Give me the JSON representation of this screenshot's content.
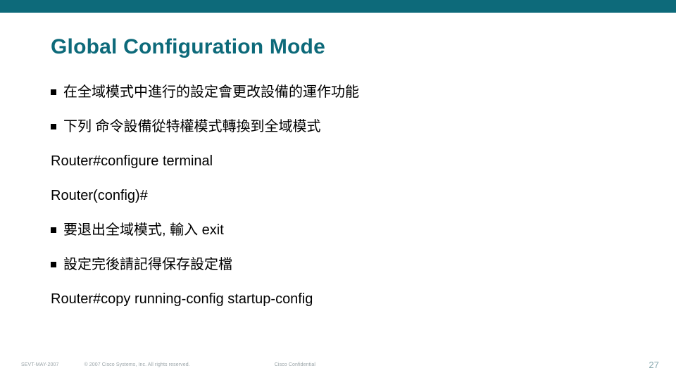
{
  "title": "Global Configuration Mode",
  "lines": [
    {
      "bullet": true,
      "text": "在全域模式中進行的設定會更改設備的運作功能"
    },
    {
      "bullet": true,
      "text": "下列 命令設備從特權模式轉換到全域模式"
    },
    {
      "bullet": false,
      "text": "Router#configure terminal"
    },
    {
      "bullet": false,
      "text": "Router(config)#"
    },
    {
      "bullet": true,
      "text": "要退出全域模式, 輸入 exit"
    },
    {
      "bullet": true,
      "text": "設定完後請記得保存設定檔"
    },
    {
      "bullet": false,
      "text": "Router#copy running-config startup-config"
    }
  ],
  "footer": {
    "left": "SEVT-MAY-2007",
    "middle": "© 2007 Cisco Systems, Inc. All rights reserved.",
    "right": "Cisco Confidential",
    "page": "27"
  }
}
